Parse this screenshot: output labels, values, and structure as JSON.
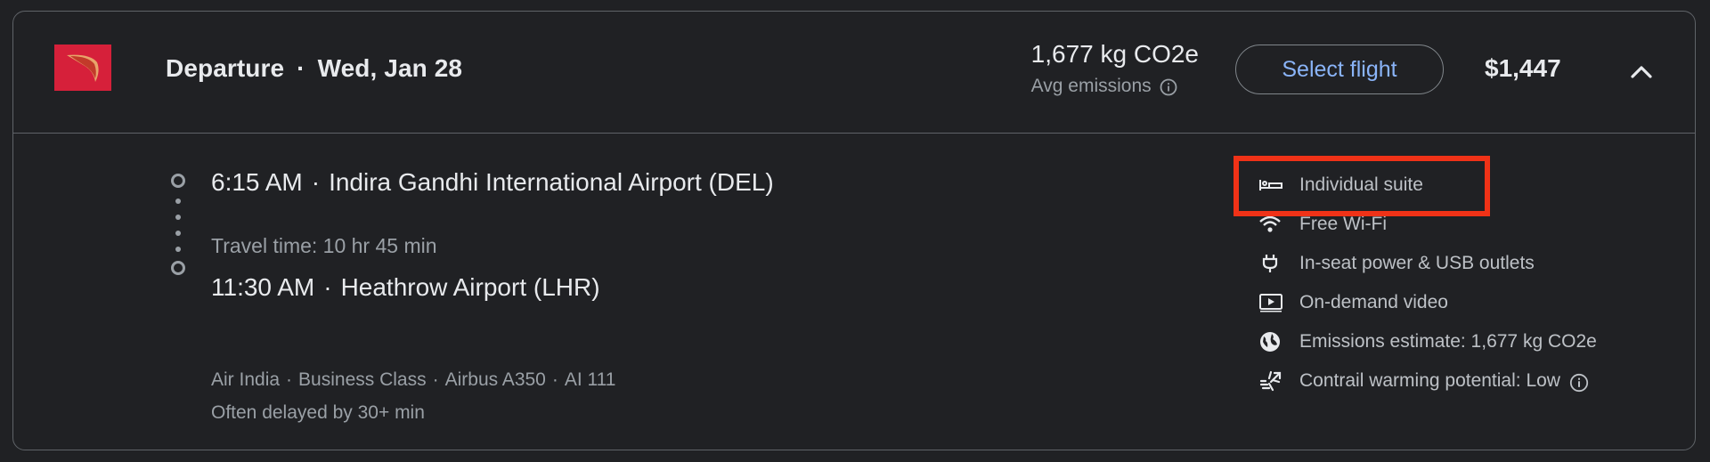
{
  "header": {
    "direction_label": "Departure",
    "date": "Wed, Jan 28",
    "emissions_value": "1,677 kg CO2e",
    "emissions_label": "Avg emissions",
    "select_button": "Select flight",
    "price": "$1,447"
  },
  "segment": {
    "departure_time": "6:15 AM",
    "departure_airport": "Indira Gandhi International Airport (DEL)",
    "travel_time": "Travel time: 10 hr 45 min",
    "arrival_time": "11:30 AM",
    "arrival_airport": "Heathrow Airport (LHR)",
    "airline": "Air India",
    "cabin": "Business Class",
    "aircraft": "Airbus A350",
    "flight_number": "AI 111",
    "delay_note": "Often delayed by 30+ min"
  },
  "amenities": [
    {
      "icon": "bed-icon",
      "label": "Individual suite"
    },
    {
      "icon": "wifi-icon",
      "label": "Free Wi-Fi"
    },
    {
      "icon": "power-plug-icon",
      "label": "In-seat power & USB outlets"
    },
    {
      "icon": "video-icon",
      "label": "On-demand video"
    },
    {
      "icon": "globe-icon",
      "label": "Emissions estimate: 1,677 kg CO2e"
    },
    {
      "icon": "contrail-icon",
      "label": "Contrail warming potential: Low"
    }
  ],
  "colors": {
    "background": "#202124",
    "text_primary": "#e8eaed",
    "text_secondary": "#9aa0a6",
    "accent_blue": "#8ab4f8",
    "highlight_red": "#f03217",
    "logo_red": "#d6203a"
  }
}
